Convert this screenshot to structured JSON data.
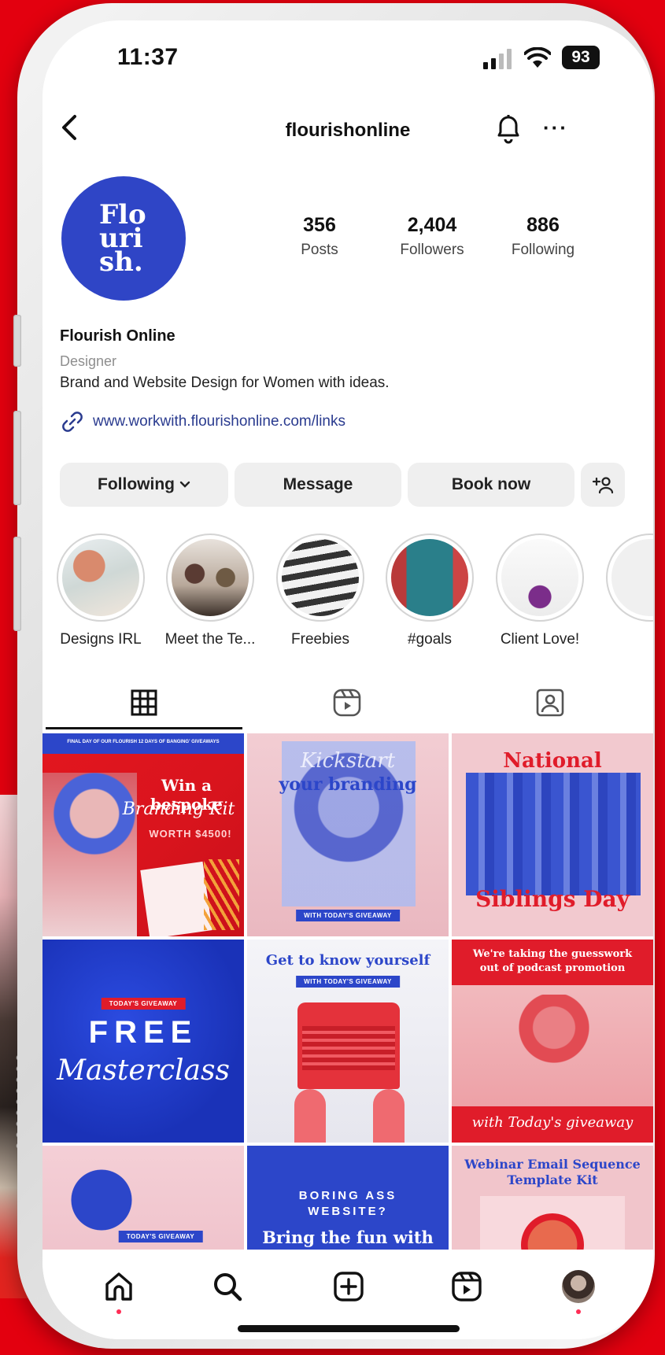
{
  "status_bar": {
    "time": "11:37",
    "battery": "93"
  },
  "header": {
    "username": "flourishonline"
  },
  "profile": {
    "avatar_text": "Flo uri sh.",
    "stats": [
      {
        "value": "356",
        "label": "Posts"
      },
      {
        "value": "2,404",
        "label": "Followers"
      },
      {
        "value": "886",
        "label": "Following"
      }
    ],
    "display_name": "Flourish Online",
    "category": "Designer",
    "bio": "Brand and Website Design for Women with ideas.",
    "link": "www.workwith.flourishonline.com/links"
  },
  "actions": {
    "following": "Following",
    "message": "Message",
    "book": "Book now"
  },
  "highlights": [
    {
      "label": "Designs IRL"
    },
    {
      "label": "Meet the Te..."
    },
    {
      "label": "Freebies"
    },
    {
      "label": "#goals"
    },
    {
      "label": "Client Love!"
    }
  ],
  "tabs": [
    "grid-icon",
    "reels-icon",
    "tagged-icon"
  ],
  "posts": {
    "p1": {
      "top": "FINAL DAY OF OUR FLOURISH 12 DAYS OF BANGING' GIVEAWAYS",
      "title": "Win a bespoke",
      "script": "Branding Kit",
      "sub": "WORTH $4500!"
    },
    "p2": {
      "script": "Kickstart",
      "title": "your branding",
      "tag": "WITH TODAY'S GIVEAWAY"
    },
    "p3": {
      "title1": "National",
      "title2": "Siblings Day"
    },
    "p4": {
      "tag": "TODAY'S GIVEAWAY",
      "title": "FREE",
      "script": "Masterclass"
    },
    "p5": {
      "title": "Get to know yourself",
      "tag": "WITH TODAY'S GIVEAWAY"
    },
    "p6": {
      "title": "We're taking the guesswork out of podcast promotion",
      "script": "with Today's giveaway"
    },
    "p7": {
      "tag": "TODAY'S GIVEAWAY"
    },
    "p8": {
      "title": "BORING ASS WEBSITE?",
      "sub": "Bring the fun with"
    },
    "p9": {
      "title": "Webinar Email Sequence Template Kit"
    }
  },
  "colors": {
    "brand_blue": "#2c46c9",
    "brand_red": "#e3000f",
    "pink": "#f2c9cf"
  }
}
